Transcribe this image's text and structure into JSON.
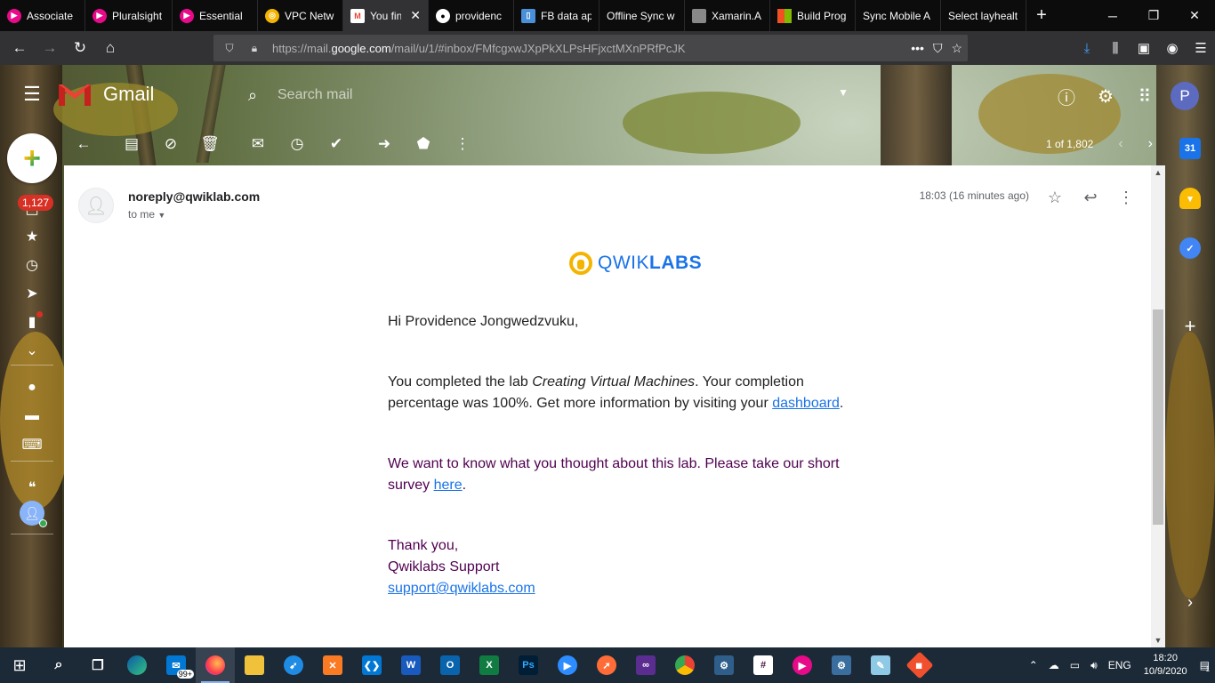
{
  "browser": {
    "tabs": [
      {
        "label": "Associate",
        "icon": "pluralsight-icon",
        "color": "#e80a89"
      },
      {
        "label": "Pluralsight",
        "icon": "pluralsight-icon",
        "color": "#e80a89"
      },
      {
        "label": "Essential",
        "icon": "pluralsight-icon",
        "color": "#e80a89"
      },
      {
        "label": "VPC Netw",
        "icon": "qwiklabs-icon",
        "color": "#f4b400"
      },
      {
        "label": "You fin",
        "icon": "gmail-icon",
        "color": "#ea4335",
        "active": true
      },
      {
        "label": "providenc",
        "icon": "github-icon",
        "color": "#ffffff"
      },
      {
        "label": "FB data ap",
        "icon": "page-icon",
        "color": "#4a90d9"
      },
      {
        "label": "Offline Sync w",
        "icon": "none",
        "color": ""
      },
      {
        "label": "Xamarin.A",
        "icon": "page-icon",
        "color": "#888888"
      },
      {
        "label": "Build Prog",
        "icon": "microsoft-icon",
        "color": "#f25022"
      },
      {
        "label": "Sync Mobile A",
        "icon": "none",
        "color": ""
      },
      {
        "label": "Select layhealt",
        "icon": "none",
        "color": ""
      }
    ],
    "url_prefix": "https://mail.",
    "url_domain": "google.com",
    "url_rest": "/mail/u/1/#inbox/FMfcgxwJXpPkXLPsHFjxctMXnPRfPcJK"
  },
  "gmail": {
    "app_name": "Gmail",
    "search_placeholder": "Search mail",
    "avatar_letter": "P",
    "unread_count": "1,127",
    "pager_text": "1 of 1,802"
  },
  "message": {
    "from": "noreply@qwiklab.com",
    "to": "to me",
    "time": "18:03 (16 minutes ago)",
    "logo_light": "QWIK",
    "logo_bold": "LABS",
    "greeting": "Hi Providence Jongwedzvuku,",
    "p2_before": "You completed the lab ",
    "p2_lab": "Creating Virtual Machines",
    "p2_after": ". Your completion percentage was 100%. Get more information by visiting your ",
    "p2_link": "dashboard",
    "p2_end": ".",
    "p3_before": "We want to know what you thought about this lab. Please take our short survey ",
    "p3_link": "here",
    "p3_end": ".",
    "thanks": "Thank you,",
    "signature": "Qwiklabs Support",
    "support_email": "support@qwiklabs.com"
  },
  "side_panel": {
    "calendar_day": "31"
  },
  "taskbar": {
    "mail_badge": "99+",
    "language": "ENG",
    "time": "18:20",
    "date": "10/9/2020",
    "notifications": "1"
  }
}
